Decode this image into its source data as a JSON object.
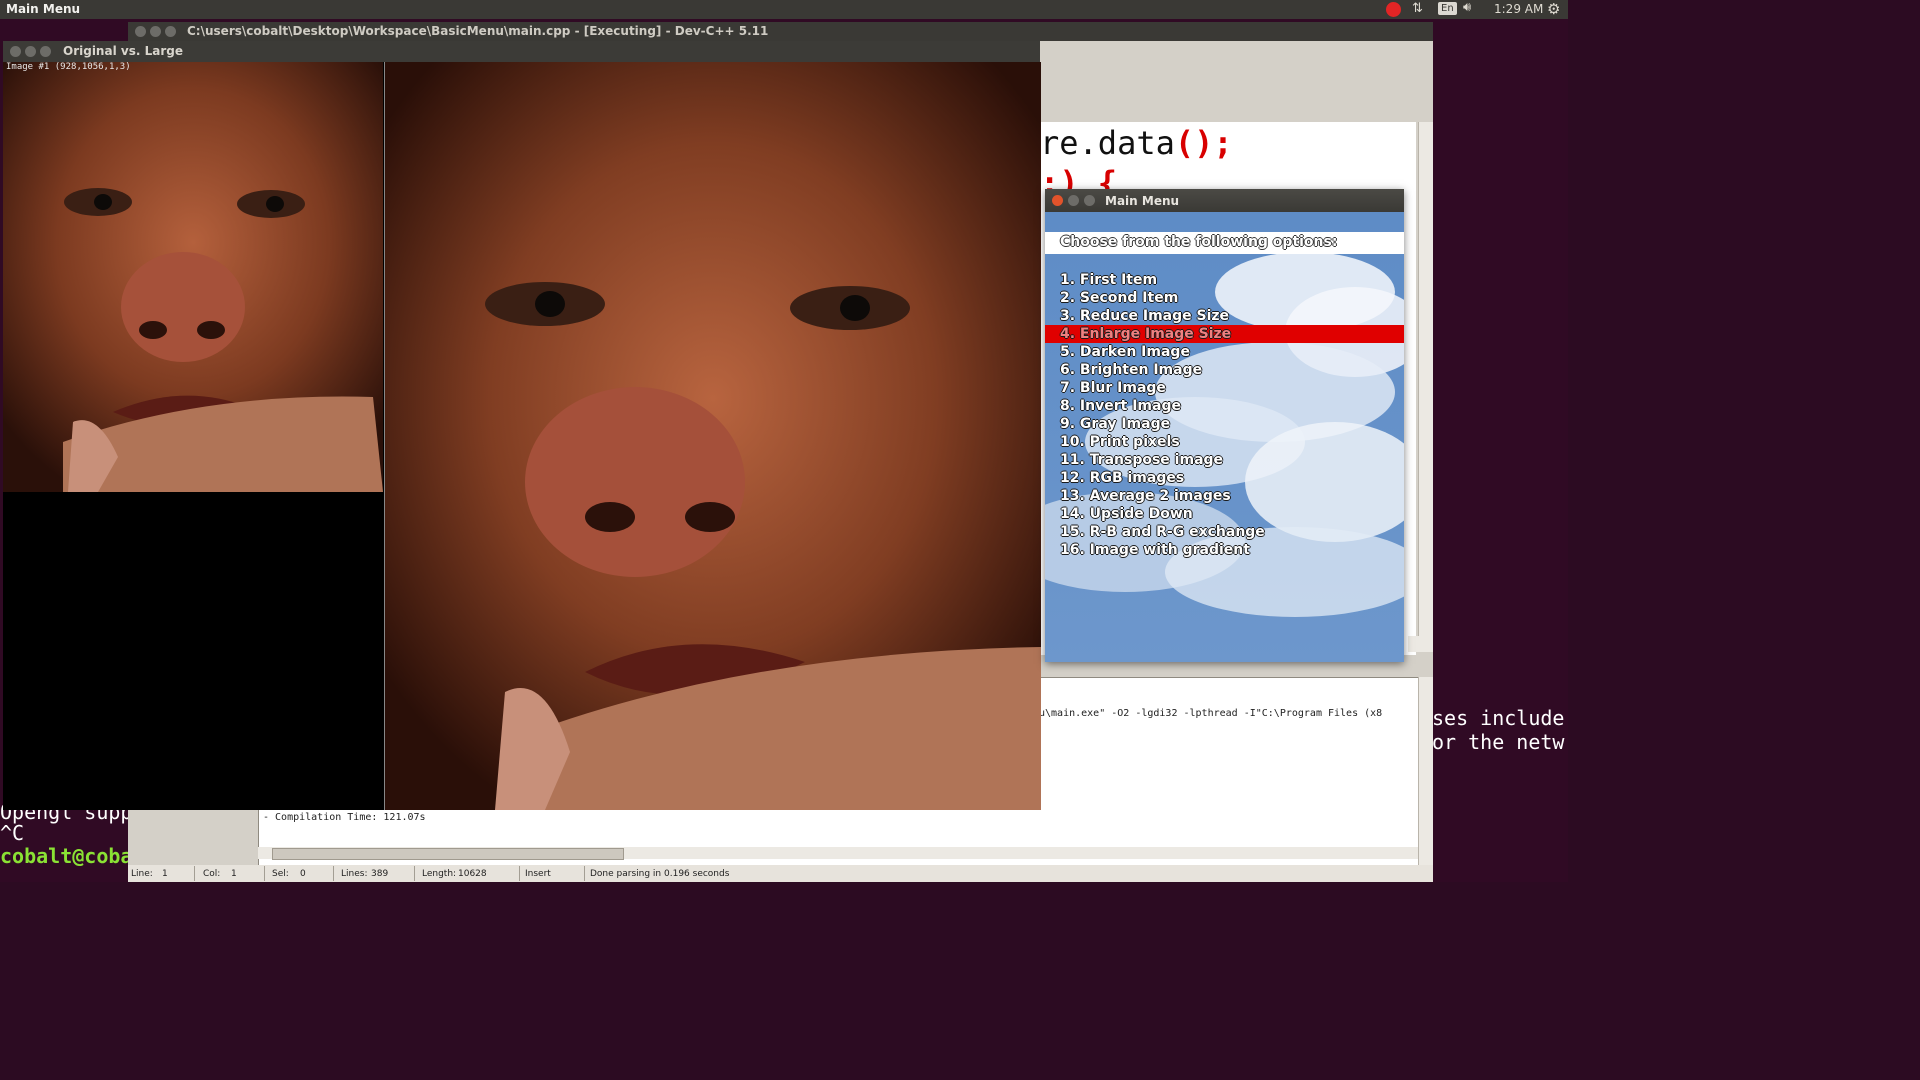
{
  "top_panel": {
    "title": "Main Menu",
    "keyboard": "En",
    "clock": "1:29 AM"
  },
  "terminal": {
    "right_line_1": "ses include",
    "right_line_2": "or the netw",
    "line_1": "Opengl supp",
    "line_2": "^C",
    "prompt": "cobalt@coba"
  },
  "devcpp": {
    "title": "C:\\users\\cobalt\\Desktop\\Workspace\\BasicMenu\\main.cpp - [Executing] - Dev-C++ 5.11",
    "code_line_1_a": "re.data",
    "code_line_1_b": "();",
    "code_line_2": ":) {",
    "compile_cmd": "u\\main.exe\" -O2 -lgdi32 -lpthread -I\"C:\\Program Files (x8",
    "compile_time": "- Compilation Time: 121.07s",
    "status": {
      "line_label": "Line:",
      "line_value": "1",
      "col_label": "Col:",
      "col_value": "1",
      "sel_label": "Sel:",
      "sel_value": "0",
      "lines_label": "Lines:",
      "lines_value": "389",
      "length_label": "Length:",
      "length_value": "10628",
      "mode": "Insert",
      "parse": "Done parsing in 0.196 seconds"
    }
  },
  "viewer": {
    "title": "Original vs. Large",
    "info": "Image #1 (928,1056,1,3)"
  },
  "menu": {
    "title": "Main Menu",
    "header": "Choose from the following options:",
    "selected_index": 3,
    "items": [
      "1. First Item",
      "2. Second Item",
      "3. Reduce Image Size",
      "4. Enlarge Image Size",
      "5. Darken Image",
      "6. Brighten Image",
      "7. Blur Image",
      "8. Invert Image",
      "9. Gray Image",
      "10. Print pixels",
      "11. Transpose image",
      "12. RGB images",
      "13. Average 2 images",
      "14. Upside Down",
      "15. R-B and R-G exchange",
      "16. Image with gradient"
    ]
  },
  "colors": {
    "terminal_bg": "#300a24",
    "panel_bg": "#3a3935",
    "menu_highlight": "#e00000",
    "menu_sky": "#6a93c7"
  }
}
